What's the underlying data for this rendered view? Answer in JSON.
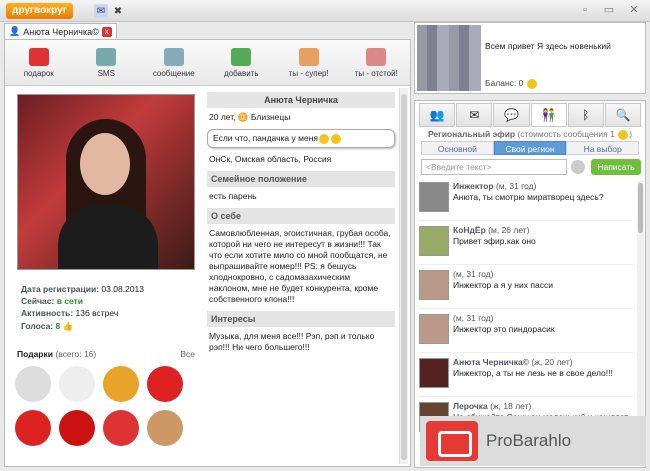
{
  "app": {
    "logo": "другвокруг",
    "minimize": "▫",
    "restore": "▭",
    "close": "✕"
  },
  "tab": {
    "label": "Анюта Черничка©",
    "close": "x"
  },
  "toolbar": [
    {
      "label": "подарок",
      "color": "#d33"
    },
    {
      "label": "SMS",
      "color": "#7aa"
    },
    {
      "label": "сообщение",
      "color": "#8ab"
    },
    {
      "label": "добавить",
      "color": "#5a5"
    },
    {
      "label": "ты - супер!",
      "color": "#e8a060"
    },
    {
      "label": "ты - отстой!",
      "color": "#d88"
    }
  ],
  "profile": {
    "reg_label": "Дата регистрации:",
    "reg_value": "03.08.2013",
    "now_label": "Сейчас:",
    "now_value": "в сети",
    "act_label": "Активность:",
    "act_value": "136 встреч",
    "votes_label": "Голоса:",
    "votes_value": "8",
    "gifts_label": "Подарки",
    "gifts_count": "(всего: 16)",
    "gifts_all": "Все",
    "name": "Анюта Черничка",
    "age_sign": "20 лет,",
    "sign": "Близнецы",
    "status": "Если что, пандачка у меня",
    "location": "ОнСк, Омская область, Россия",
    "family_hdr": "Семейное положение",
    "family_val": "есть парень",
    "about_hdr": "О себе",
    "about_text": "Самовлюбленная, эгоистичная, грубая особа, которой ни чего не интересут в жизни!!! Так что если хотите мило со мной пообщатся, не выпрашивайте номер!!! PS: я бешусь хлоднокровно, с садомазахическим наклоном, мне не будет конкурента, кроме собственного клона!!!",
    "interests_hdr": "Интересы",
    "interests_text": "Музыка, для меня все!!! Рэп, рэп и только рэп!!! Ни чего большего!!!"
  },
  "gift_colors": [
    "#ddd",
    "#eee",
    "#e9a32a",
    "#d22",
    "#d22",
    "#c11",
    "#d33",
    "#c96"
  ],
  "me": {
    "status": "Всем привет  Я здесь новенький",
    "balance": "Баланс: 0"
  },
  "efir": {
    "title": "Региональный эфир",
    "cost": "(стоимость сообщения 1",
    "seg": [
      "Основной",
      "Свой регион",
      "На выбор"
    ],
    "placeholder": "<Введите текст>",
    "send": "Написать"
  },
  "messages": [
    {
      "name": "Инжектор",
      "meta": "(м, 31 год)",
      "text": "Анюта, ты смотрю миратворец здесь?",
      "av": "#888"
    },
    {
      "name": "КоНдЁр",
      "meta": "(м, 26 лет)",
      "text": "Привет эфир.как оно",
      "av": "#9a6"
    },
    {
      "name": "",
      "meta": "(м, 31 год)",
      "text": "Инжектор  а я у них пасси",
      "av": "#b98"
    },
    {
      "name": "",
      "meta": "(м, 31 год)",
      "text": "Инжектор  это пиндорасик",
      "av": "#b98"
    },
    {
      "name": "Анюта Черничка©",
      "meta": "(ж, 20 лет)",
      "text": "Инжектор, а ты не лезь не в свое дело!!!",
      "av": "#522"
    },
    {
      "name": "Лерочка",
      "meta": "(ж, 18 лет)",
      "text": "Не обижайте Сашу он маленький и кашляет Саш",
      "av": "#643"
    }
  ],
  "watermark": "ProBarahlo"
}
